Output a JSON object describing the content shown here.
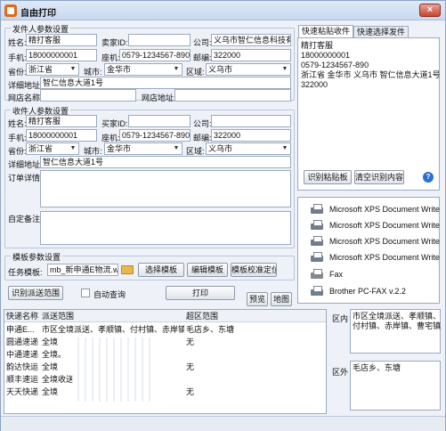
{
  "window": {
    "title": "自由打印",
    "close": "×"
  },
  "sender": {
    "title": "发件人参数设置",
    "name_label": "姓名:",
    "name": "精打客服",
    "seller_label": "卖家ID:",
    "seller": "",
    "company_label": "公司:",
    "company": "义乌市智仁信息科技有",
    "mobile_label": "手机:",
    "mobile": "18000000001",
    "phone_label": "座机:",
    "phone": "0579-1234567-890",
    "zip_label": "邮编:",
    "zip": "322000",
    "province_label": "省份:",
    "province": "浙江省",
    "city_label": "城市:",
    "city": "金华市",
    "district_label": "区域:",
    "district": "义乌市",
    "address_label": "详细地址:",
    "address": "智仁信息大道1号",
    "shop_label": "网店名称:",
    "shop": "",
    "shop_url_label": "网店地址:",
    "shop_url": ""
  },
  "receiver": {
    "title": "收件人参数设置",
    "name_label": "姓名:",
    "name": "精打客服",
    "buyer_label": "买家ID:",
    "buyer": "",
    "company_label": "公司:",
    "company": "",
    "mobile_label": "手机:",
    "mobile": "18000000001",
    "phone_label": "座机:",
    "phone": "0579-1234567-890",
    "zip_label": "邮编:",
    "zip": "322000",
    "province_label": "省份:",
    "province": "浙江省",
    "city_label": "城市:",
    "city": "金华市",
    "district_label": "区域:",
    "district": "义乌市",
    "address_label": "详细地址:",
    "address": "智仁信息大道1号",
    "order_label": "订单详情:",
    "remark_label": "自定备注:"
  },
  "tabs": {
    "paste": "快速粘贴收件人",
    "choose": "快速选择发件人"
  },
  "paste_text": [
    "精打客服",
    "18000000001",
    "0579-1234567-890",
    "浙江省 金华市 义乌市 智仁信息大道1号",
    "322000"
  ],
  "paste_buttons": {
    "recognize": "识别粘贴板",
    "clear": "清空识别内容",
    "help": "?"
  },
  "printers": [
    "Microsoft XPS Document Write",
    "Microsoft XPS Document Write",
    "Microsoft XPS Document Write",
    "Microsoft XPS Document Write",
    "Fax",
    "Brother PC-FAX v.2.2"
  ],
  "template": {
    "title": "模板参数设置",
    "task_label": "任务模板:",
    "task_value": "mb_新申通E物流.wml",
    "choose": "选择模板",
    "edit": "编辑模板",
    "calibrate": "模板校准定位"
  },
  "actions": {
    "recognize_range": "识别派送范围",
    "auto_query": "自动查询",
    "print": "打印",
    "preview": "预览",
    "map": "地图"
  },
  "table": {
    "headers": [
      "快递名称",
      "派送范围",
      "超区范围"
    ],
    "rows": [
      [
        "申通E...",
        "市区全境派送、孝顺镇、付村镇、赤岸镇、...",
        "毛店乡、东塘"
      ],
      [
        "圆通速递",
        "全境",
        "无"
      ],
      [
        "中通速递",
        "全境。",
        ""
      ],
      [
        "韵达快运",
        "全境",
        "无"
      ],
      [
        "顺丰速运",
        "全境收送",
        ""
      ],
      [
        "天天快递",
        "全境",
        "无"
      ]
    ]
  },
  "area": {
    "inner_label": "区内",
    "inner_text": [
      "市区全境派送、孝顺镇、",
      "付村镇、赤岸镇、曹宅镇"
    ],
    "outer_label": "区外",
    "outer_text": "毛店乡、东塘"
  },
  "colors": {
    "accent": "#2c6fd4",
    "title_bg": "#c7d8ef",
    "window_bg": "#eef2f8"
  }
}
